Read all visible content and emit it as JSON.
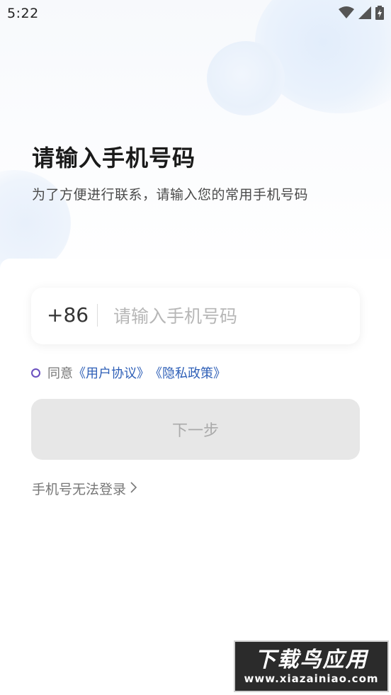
{
  "status_bar": {
    "time": "5:22",
    "icons": [
      "wifi-icon",
      "signal-icon",
      "battery-charging-icon"
    ]
  },
  "header": {
    "title": "请输入手机号码",
    "subtitle": "为了方便进行联系，请输入您的常用手机号码"
  },
  "phone": {
    "country_code": "+86",
    "placeholder": "请输入手机号码",
    "value": ""
  },
  "agreement": {
    "prefix": "同意",
    "user_agreement": "《用户协议》",
    "privacy_policy": "《隐私政策》",
    "checked": false
  },
  "next_button": {
    "label": "下一步",
    "enabled": false
  },
  "cannot_login": {
    "label": "手机号无法登录"
  },
  "watermark": {
    "title": "下载鸟应用",
    "url": "www.xiazainiao.com"
  },
  "colors": {
    "accent_link": "#2e5fb7",
    "radio_border": "#6a4fbf",
    "disabled_button": "#e7e7e7"
  }
}
